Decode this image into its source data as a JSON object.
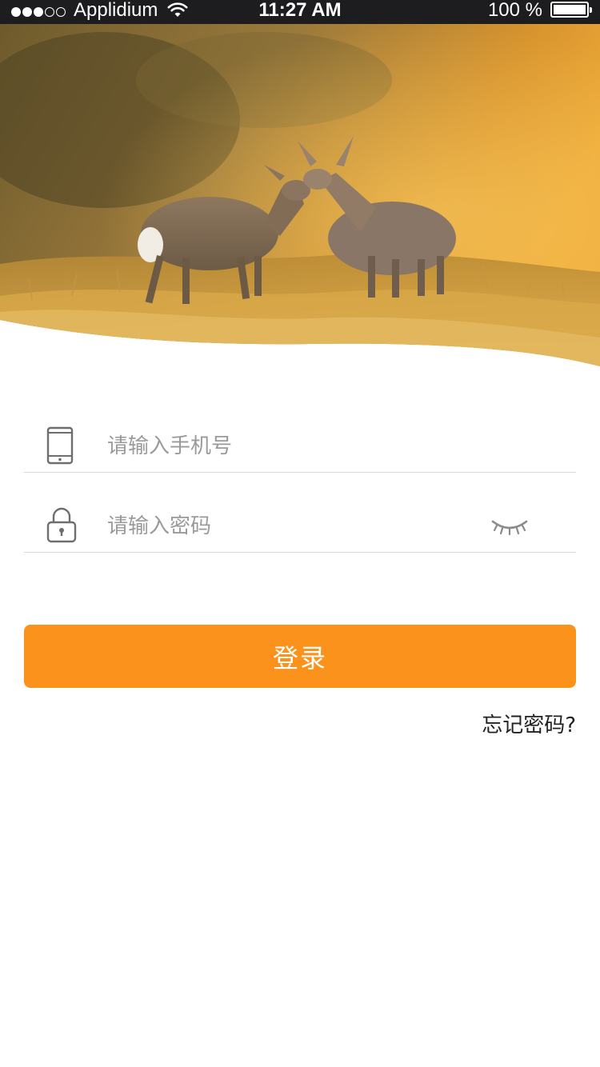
{
  "status_bar": {
    "signal_filled": 3,
    "signal_total": 5,
    "carrier": "Applidium",
    "wifi_icon": "wifi-icon",
    "time": "11:27 AM",
    "battery_percent": "100 %",
    "battery_level": 1.0,
    "battery_icon": "battery-icon"
  },
  "hero": {
    "image": "deer-photo",
    "tone": "#d98a24"
  },
  "form": {
    "phone": {
      "icon": "phone-icon",
      "placeholder": "请输入手机号",
      "value": ""
    },
    "password": {
      "icon": "lock-icon",
      "placeholder": "请输入密码",
      "value": "",
      "toggle_icon": "closed-eye-icon"
    }
  },
  "login_button": {
    "label": "登录",
    "color": "#fb921c"
  },
  "forgot_password": {
    "label": "忘记密码?"
  }
}
